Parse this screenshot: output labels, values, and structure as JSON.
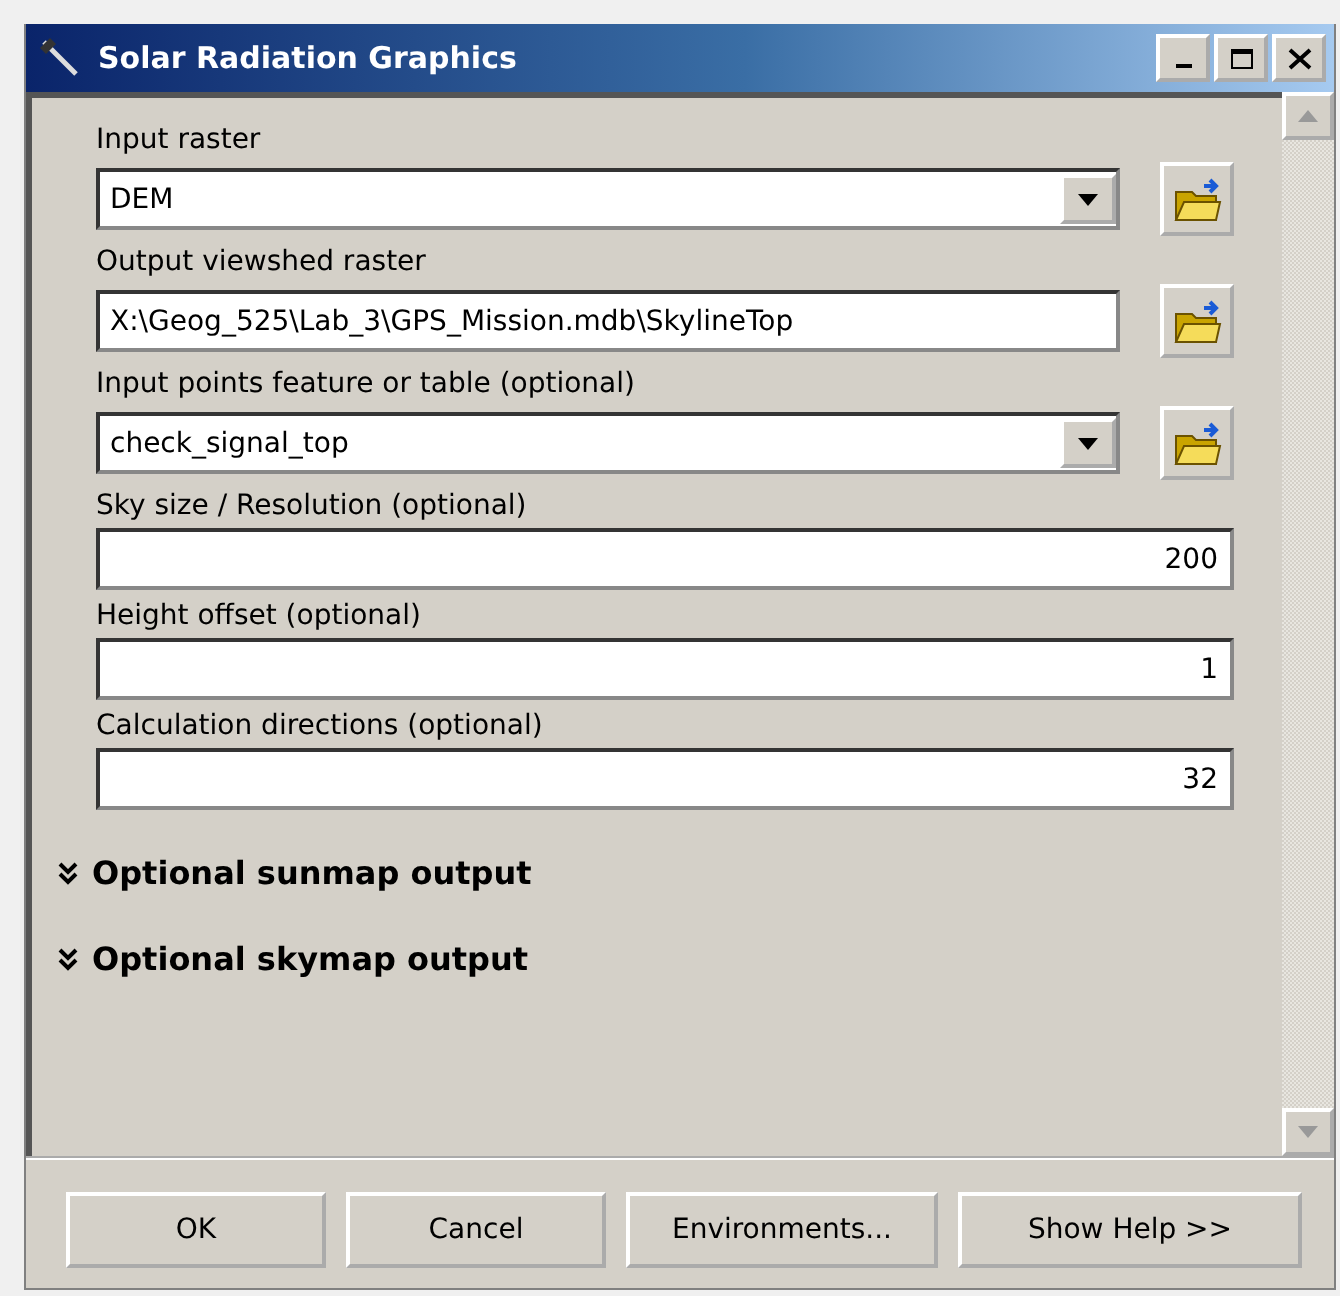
{
  "window": {
    "title": "Solar Radiation Graphics"
  },
  "parameters": [
    {
      "label": "Input raster",
      "kind": "combo",
      "value": "DEM",
      "browse": true
    },
    {
      "label": "Output viewshed raster",
      "kind": "text",
      "value": "X:\\Geog_525\\Lab_3\\GPS_Mission.mdb\\SkylineTop",
      "browse": true
    },
    {
      "label": "Input points feature or table (optional)",
      "kind": "combo",
      "value": "check_signal_top",
      "browse": true
    },
    {
      "label": "Sky size / Resolution (optional)",
      "kind": "number",
      "value": "200",
      "browse": false
    },
    {
      "label": "Height offset (optional)",
      "kind": "number",
      "value": "1",
      "browse": false
    },
    {
      "label": "Calculation directions (optional)",
      "kind": "number",
      "value": "32",
      "browse": false
    }
  ],
  "sections": [
    {
      "label": "Optional sunmap output",
      "expanded": false
    },
    {
      "label": "Optional skymap output",
      "expanded": false
    }
  ],
  "buttons": [
    "OK",
    "Cancel",
    "Environments...",
    "Show Help >>"
  ]
}
